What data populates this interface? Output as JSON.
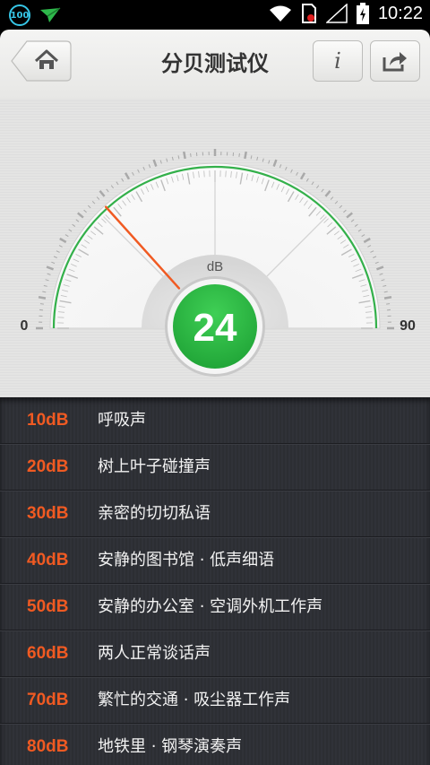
{
  "status_bar": {
    "notification_badge": "100",
    "time": "10:22",
    "icons": [
      "wifi-icon",
      "no-sim-icon",
      "signal-icon",
      "battery-charging-icon"
    ]
  },
  "header": {
    "title": "分贝测试仪",
    "home_icon": "home-icon",
    "info_label": "i",
    "share_icon": "share-icon"
  },
  "gauge": {
    "unit": "dB",
    "min_label": "0",
    "max_label": "90",
    "value": "24",
    "needle_value": 24,
    "min": 0,
    "max": 90,
    "accent_color": "#33b04a",
    "needle_color": "#f05a22"
  },
  "reference_list": [
    {
      "db": "10dB",
      "desc": "呼吸声"
    },
    {
      "db": "20dB",
      "desc": "树上叶子碰撞声"
    },
    {
      "db": "30dB",
      "desc": "亲密的切切私语"
    },
    {
      "db": "40dB",
      "desc": "安静的图书馆 · 低声细语"
    },
    {
      "db": "50dB",
      "desc": "安静的办公室 · 空调外机工作声"
    },
    {
      "db": "60dB",
      "desc": "两人正常谈话声"
    },
    {
      "db": "70dB",
      "desc": "繁忙的交通 · 吸尘器工作声"
    },
    {
      "db": "80dB",
      "desc": "地铁里 · 钢琴演奏声"
    }
  ]
}
